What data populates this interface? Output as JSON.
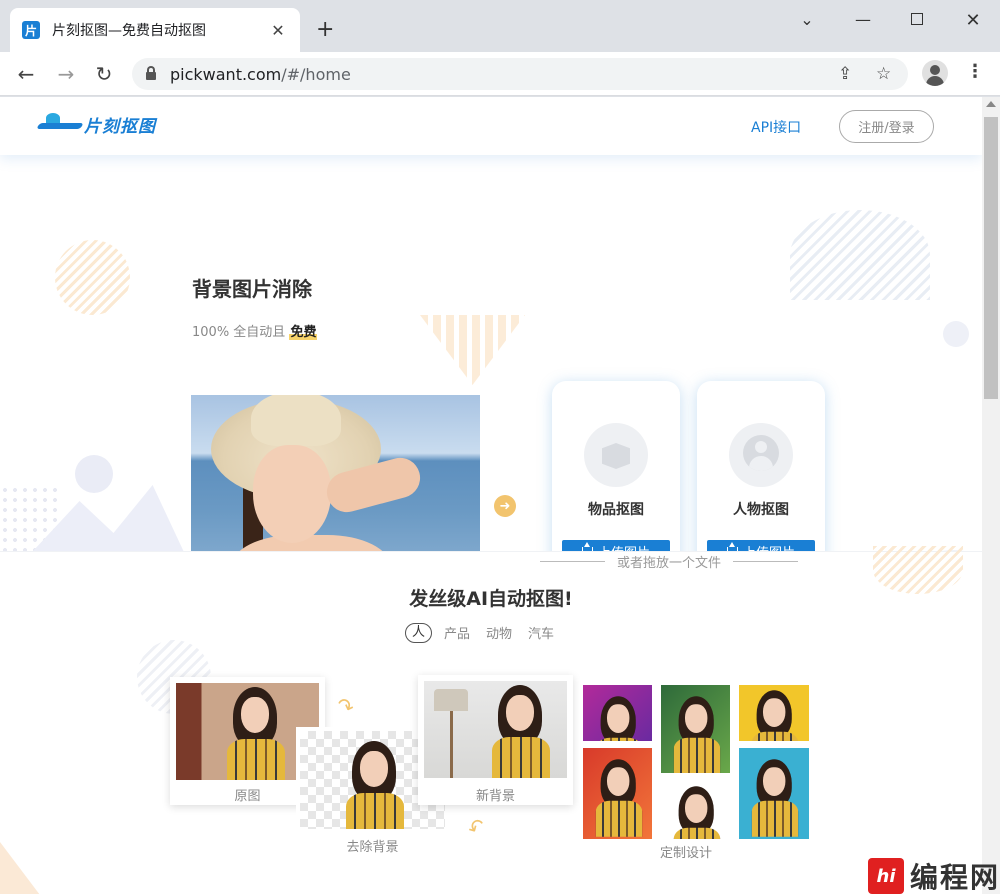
{
  "browser": {
    "tab_title": "片刻抠图—免费自动抠图",
    "favicon_glyph": "片",
    "tab_close": "✕",
    "new_tab": "+",
    "url_host": "pickwant.com",
    "url_path": "/#/home",
    "icons": [
      "lock-icon",
      "share-icon",
      "star-icon",
      "profile-icon",
      "menu-icon"
    ]
  },
  "header": {
    "logo_text": "片刻抠图",
    "api_link": "API接口",
    "login_button": "注册/登录"
  },
  "hero": {
    "title": "背景图片消除",
    "subtitle_prefix": "100% 全自动且 ",
    "subtitle_highlight": "免费",
    "cards": [
      {
        "label": "物品抠图",
        "upload": "上传图片",
        "icon": "box-icon"
      },
      {
        "label": "人物抠图",
        "upload": "上传图片",
        "icon": "person-icon"
      }
    ],
    "drop_hint": "或者拖放一个文件"
  },
  "showcase": {
    "title": "发丝级AI自动抠图!",
    "tabs": [
      "人",
      "产品",
      "动物",
      "汽车"
    ],
    "active_tab": "人",
    "labels": {
      "original": "原图",
      "removed": "去除背景",
      "new_bg": "新背景",
      "custom": "定制设计"
    }
  },
  "watermark": {
    "badge": "hi",
    "text": "编程网"
  },
  "colors": {
    "brand": "#1a7fd4",
    "accent": "#f2c46e"
  }
}
